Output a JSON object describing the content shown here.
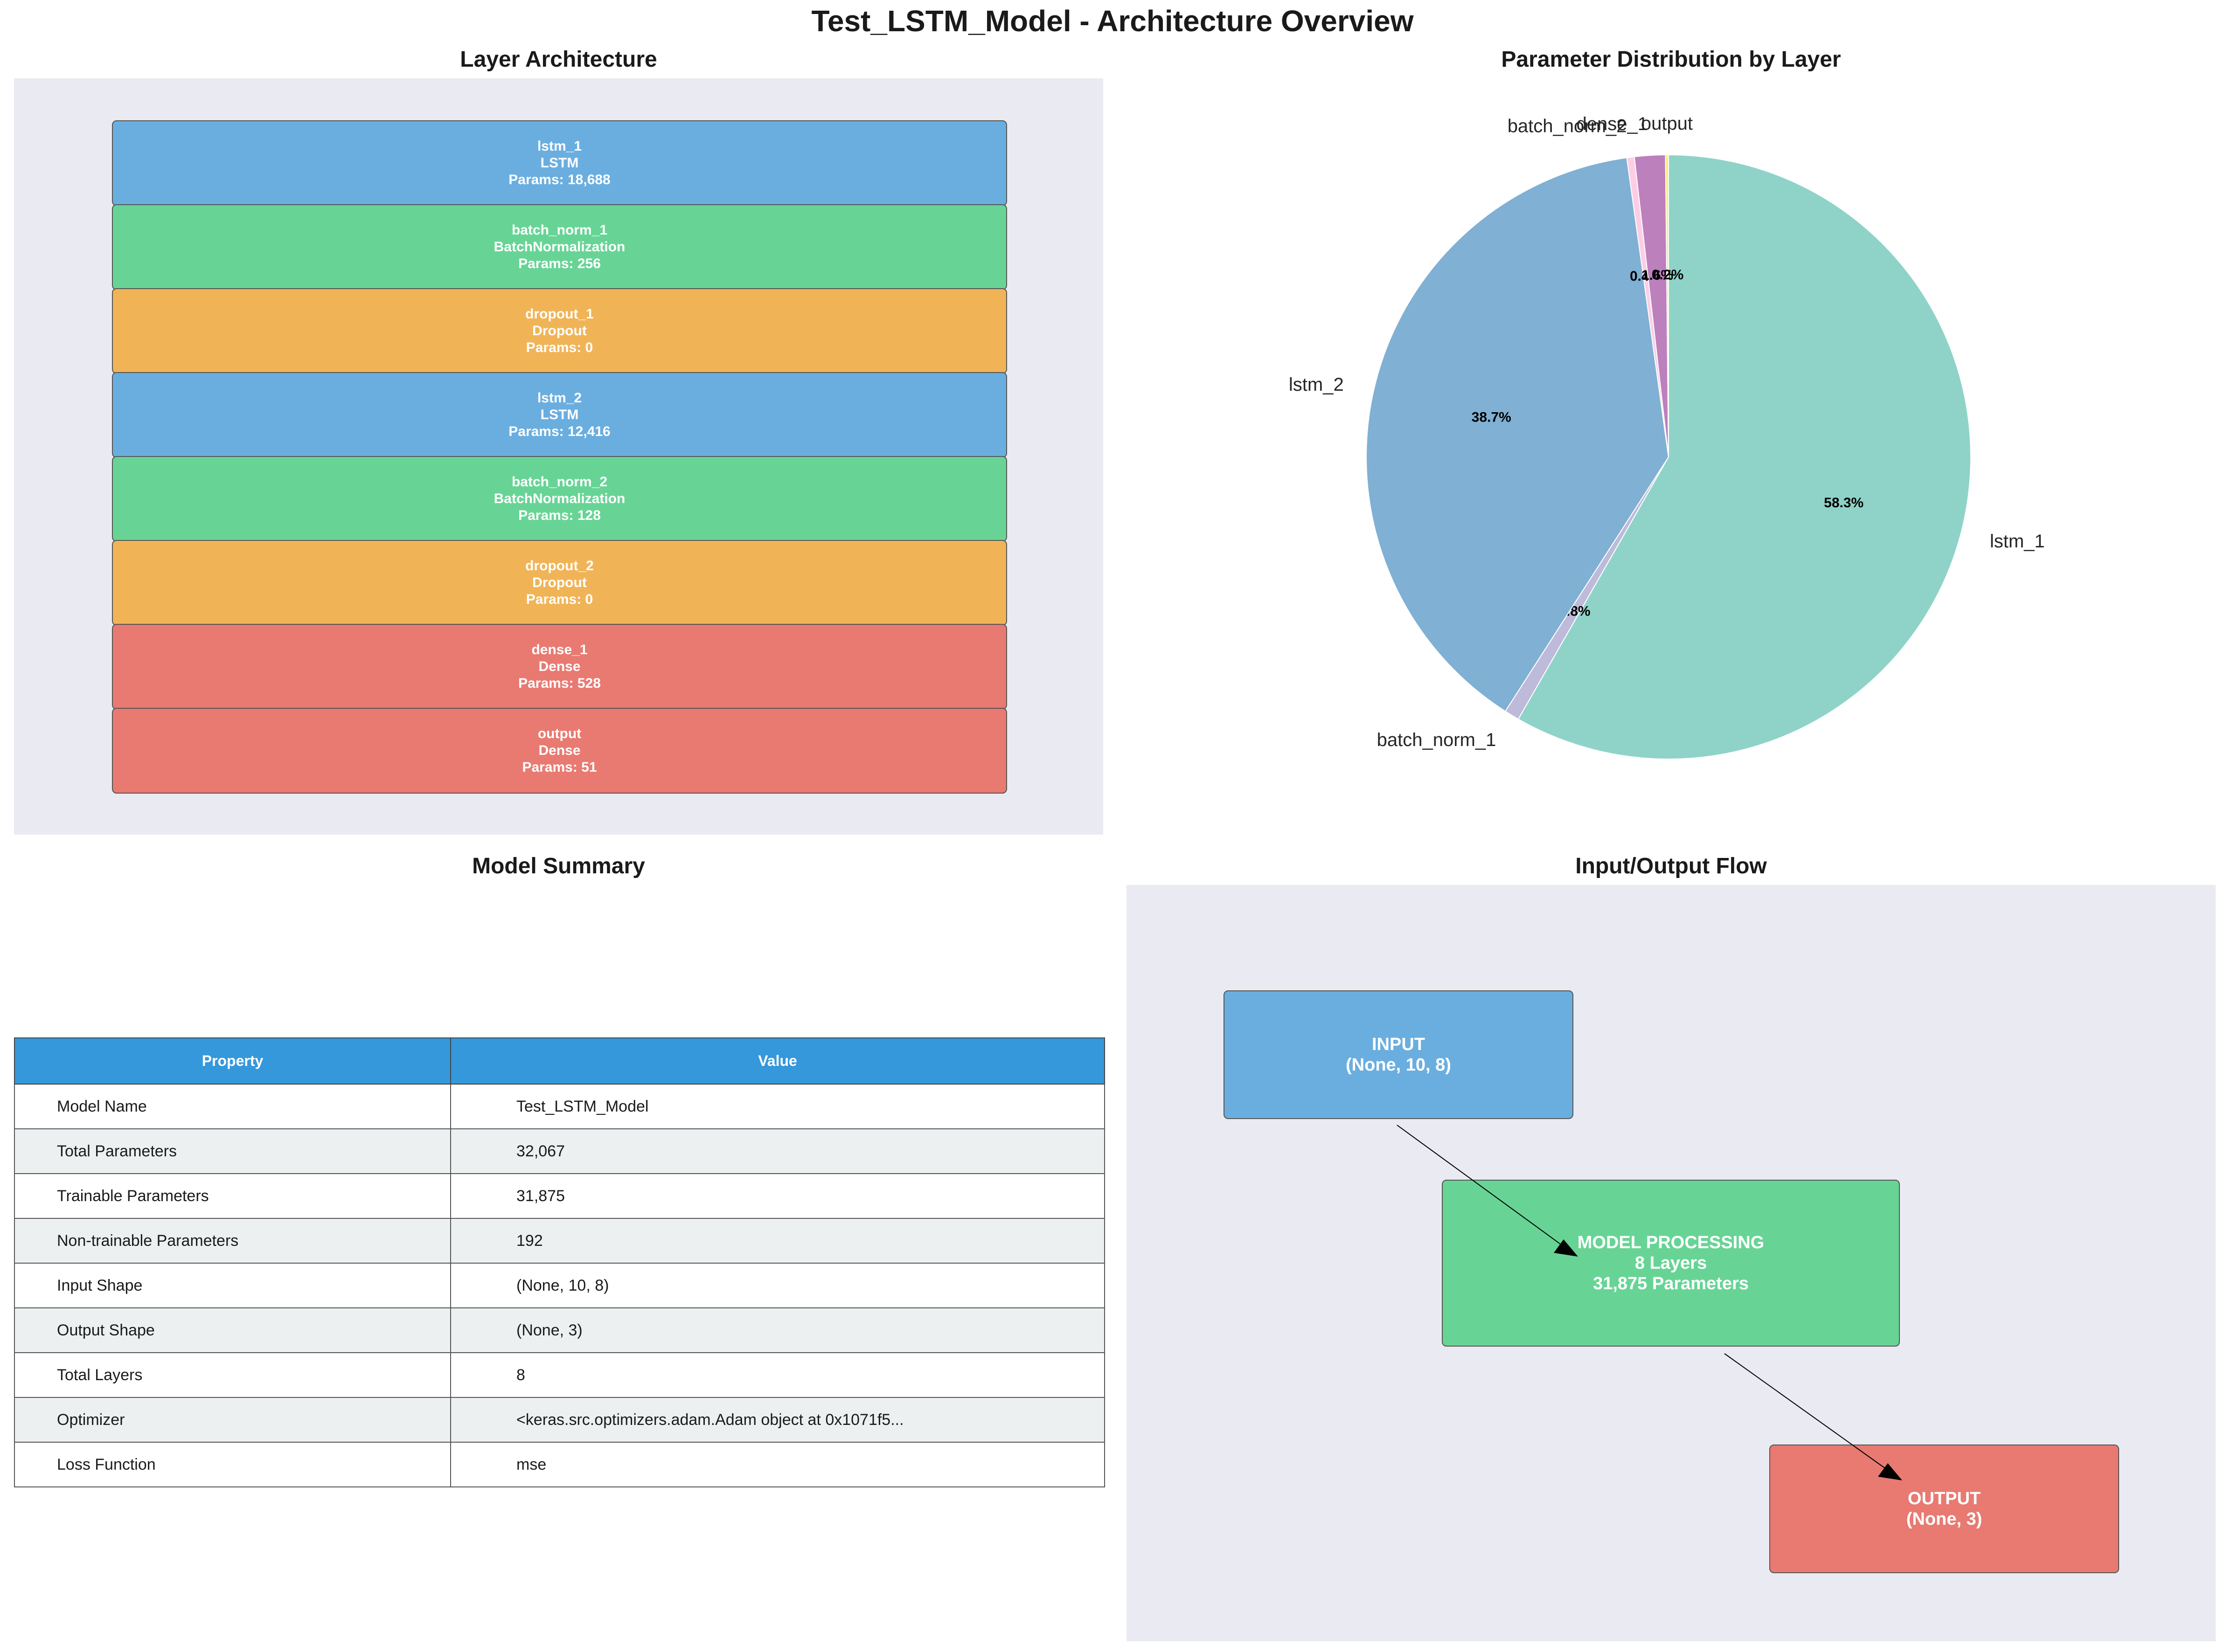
{
  "figure_title": "Test_LSTM_Model - Architecture Overview",
  "panels": {
    "layers_title": "Layer Architecture",
    "pie_title": "Parameter Distribution by Layer",
    "summary_title": "Model Summary",
    "flow_title": "Input/Output Flow"
  },
  "layers": [
    {
      "name": "lstm_1",
      "type": "LSTM",
      "params": "Params: 18,688",
      "color": "#6aaee0"
    },
    {
      "name": "batch_norm_1",
      "type": "BatchNormalization",
      "params": "Params: 256",
      "color": "#67d495"
    },
    {
      "name": "dropout_1",
      "type": "Dropout",
      "params": "Params: 0",
      "color": "#f0b457"
    },
    {
      "name": "lstm_2",
      "type": "LSTM",
      "params": "Params: 12,416",
      "color": "#6aaee0"
    },
    {
      "name": "batch_norm_2",
      "type": "BatchNormalization",
      "params": "Params: 128",
      "color": "#67d495"
    },
    {
      "name": "dropout_2",
      "type": "Dropout",
      "params": "Params: 0",
      "color": "#f0b457"
    },
    {
      "name": "dense_1",
      "type": "Dense",
      "params": "Params: 528",
      "color": "#e87a72"
    },
    {
      "name": "output",
      "type": "Dense",
      "params": "Params: 51",
      "color": "#e87a72"
    }
  ],
  "chart_data": {
    "type": "pie",
    "title": "Parameter Distribution by Layer",
    "start_angle_deg": 90,
    "direction": "clockwise",
    "slices": [
      {
        "label": "lstm_1",
        "value": 18688,
        "pct_label": "58.3%",
        "color": "#8fd3c8"
      },
      {
        "label": "batch_norm_1",
        "value": 256,
        "pct_label": "0.8%",
        "color": "#bebada"
      },
      {
        "label": "lstm_2",
        "value": 12416,
        "pct_label": "38.7%",
        "color": "#80b0d3"
      },
      {
        "label": "batch_norm_2",
        "value": 128,
        "pct_label": "0.4%",
        "color": "#fccde5"
      },
      {
        "label": "dense_1",
        "value": 528,
        "pct_label": "1.6%",
        "color": "#bc80bd"
      },
      {
        "label": "output",
        "value": 51,
        "pct_label": "0.2%",
        "color": "#ffed6f"
      }
    ]
  },
  "summary": {
    "headers": [
      "Property",
      "Value"
    ],
    "rows": [
      [
        "Model Name",
        "Test_LSTM_Model"
      ],
      [
        "Total Parameters",
        "32,067"
      ],
      [
        "Trainable Parameters",
        "31,875"
      ],
      [
        "Non-trainable Parameters",
        "192"
      ],
      [
        "Input Shape",
        "(None, 10, 8)"
      ],
      [
        "Output Shape",
        "(None, 3)"
      ],
      [
        "Total Layers",
        "8"
      ],
      [
        "Optimizer",
        "<keras.src.optimizers.adam.Adam object at 0x1071f5..."
      ],
      [
        "Loss Function",
        "mse"
      ]
    ]
  },
  "flow": {
    "input": {
      "line1": "INPUT",
      "line2": "(None, 10, 8)",
      "color": "#6aaee0"
    },
    "model": {
      "line1": "MODEL PROCESSING",
      "line2": "8 Layers",
      "line3": "31,875 Parameters",
      "color": "#67d495"
    },
    "output": {
      "line1": "OUTPUT",
      "line2": "(None, 3)",
      "color": "#e87a72"
    }
  }
}
